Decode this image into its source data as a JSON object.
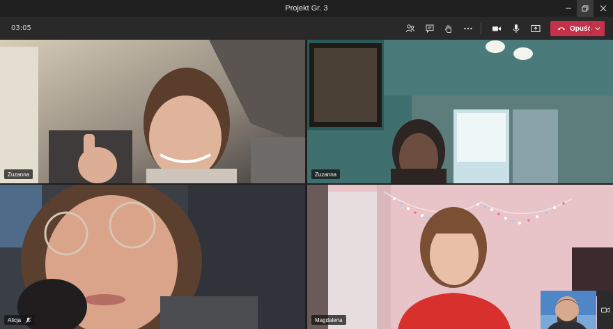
{
  "window": {
    "title": "Projekt Gr. 3"
  },
  "toolbar": {
    "timer": "03:05",
    "leave_label": "Opuść",
    "icons": [
      "participants-icon",
      "chat-icon",
      "raise-hand-icon",
      "more-icon",
      "camera-icon",
      "mic-icon",
      "share-icon",
      "leave-phone-icon",
      "chevron-down-icon"
    ]
  },
  "tiles": [
    {
      "name": "Zuzanna",
      "muted": false
    },
    {
      "name": "Zuzanna",
      "muted": false
    },
    {
      "name": "Alicja",
      "muted": true
    },
    {
      "name": "Magdalena",
      "muted": false
    }
  ],
  "colors": {
    "leave": "#c4314b",
    "titlebar": "#201f1f",
    "toolbar": "#292929"
  }
}
